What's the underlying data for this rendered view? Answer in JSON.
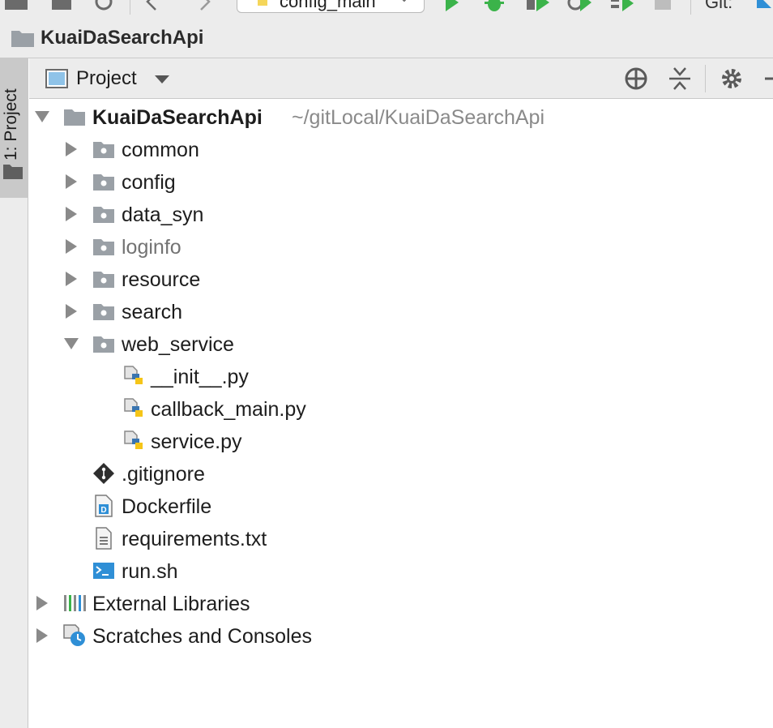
{
  "toolbar": {
    "run_config_label": "config_main",
    "git_label": "Git:",
    "run_color": "#3bb34a"
  },
  "breadcrumb": {
    "project_name": "KuaiDaSearchApi"
  },
  "tool_stripe": {
    "project_tab_label": "1: Project"
  },
  "project_panel": {
    "view_selector_label": "Project",
    "header_icons": [
      "locate-icon",
      "collapse-all-icon",
      "gear-icon",
      "hide-icon"
    ]
  },
  "tree": {
    "root": {
      "name": "KuaiDaSearchApi",
      "path": "~/gitLocal/KuaiDaSearchApi"
    },
    "folders": [
      "common",
      "config",
      "data_syn",
      "loginfo",
      "resource",
      "search",
      "web_service"
    ],
    "web_service_files": [
      "__init__.py",
      "callback_main.py",
      "service.py"
    ],
    "root_files": [
      ".gitignore",
      "Dockerfile",
      "requirements.txt",
      "run.sh"
    ],
    "external_libraries": "External Libraries",
    "scratches": "Scratches and Consoles"
  },
  "colors": {
    "panel_bg": "#ececec",
    "folder_gray": "#9aa0a6",
    "excluded_text": "#737373",
    "python_blue": "#3a75b0",
    "python_yellow": "#f5c518",
    "shell_blue": "#2f8fd6"
  }
}
